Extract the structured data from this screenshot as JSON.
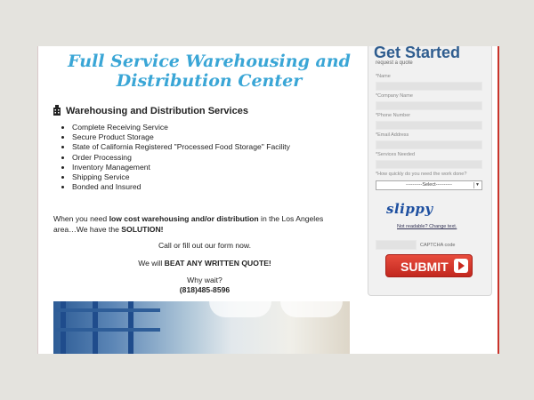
{
  "main": {
    "title": "Full Service Warehousing and Distribution Center",
    "section_heading": "Warehousing and Distribution Services",
    "services": [
      "Complete Receiving Service",
      "Secure Product Storage",
      "State of California Registered \"Processed Food Storage\" Facility",
      "Order Processing",
      "Inventory Management",
      "Shipping Service",
      "Bonded and Insured"
    ],
    "para_pre": "When you need ",
    "para_bold1": "low cost warehousing and/or distribution",
    "para_mid": " in the Los Angeles area…We have the ",
    "para_bold2": "SOLUTION!",
    "call_line": "Call or fill out our form now.",
    "beat_pre": "We will ",
    "beat_bold": "BEAT ANY WRITTEN QUOTE!",
    "why_wait": "Why wait?",
    "phone": "(818)485-8596"
  },
  "form": {
    "title": "Get Started",
    "subtitle": "request a quote",
    "fields": [
      {
        "label": "*Name"
      },
      {
        "label": "*Company Name"
      },
      {
        "label": "*Phone Number"
      },
      {
        "label": "*Email Address"
      },
      {
        "label": "*Services Needed"
      }
    ],
    "quantity_label": "*How quickly do you need the work done?",
    "quantity_selected": "----------Select----------",
    "captcha_text": "slippy",
    "captcha_link": "Not readable? Change text.",
    "captcha_label": "CAPTCHA code",
    "submit_label": "SUBMIT"
  },
  "colors": {
    "title": "#3aa6d6",
    "form_title": "#2f5d8f",
    "submit": "#d9342a",
    "page_border_right": "#c9332b"
  }
}
